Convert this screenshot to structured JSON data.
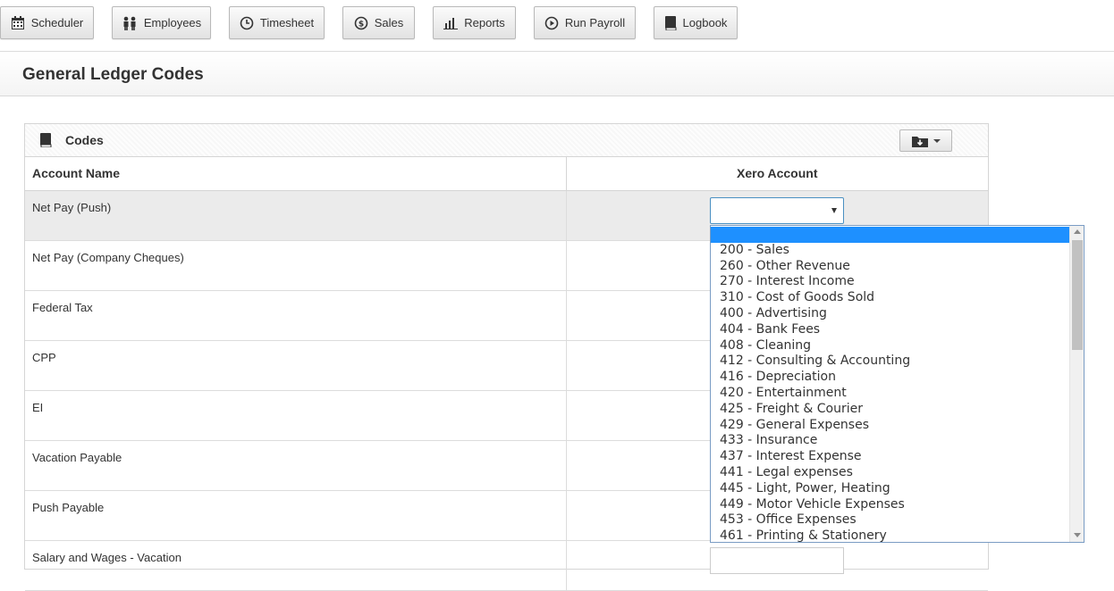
{
  "nav": {
    "items": [
      {
        "label": "Scheduler",
        "icon": "calendar-icon"
      },
      {
        "label": "Employees",
        "icon": "people-icon"
      },
      {
        "label": "Timesheet",
        "icon": "clock-icon"
      },
      {
        "label": "Sales",
        "icon": "dollar-icon"
      },
      {
        "label": "Reports",
        "icon": "bar-chart-icon"
      },
      {
        "label": "Run Payroll",
        "icon": "play-icon"
      },
      {
        "label": "Logbook",
        "icon": "book-icon"
      }
    ]
  },
  "page": {
    "title": "General Ledger Codes"
  },
  "panel": {
    "title": "Codes",
    "columns": {
      "account_name": "Account Name",
      "xero_account": "Xero Account"
    },
    "rows": [
      {
        "name": "Net Pay (Push)"
      },
      {
        "name": "Net Pay (Company Cheques)"
      },
      {
        "name": "Federal Tax"
      },
      {
        "name": "CPP"
      },
      {
        "name": "EI"
      },
      {
        "name": "Vacation Payable"
      },
      {
        "name": "Push Payable"
      },
      {
        "name": "Salary and Wages - Vacation"
      }
    ]
  },
  "dropdown": {
    "selected": "",
    "options": [
      "",
      "200 - Sales",
      "260 - Other Revenue",
      "270 - Interest Income",
      "310 - Cost of Goods Sold",
      "400 - Advertising",
      "404 - Bank Fees",
      "408 - Cleaning",
      "412 - Consulting & Accounting",
      "416 - Depreciation",
      "420 - Entertainment",
      "425 - Freight & Courier",
      "429 - General Expenses",
      "433 - Insurance",
      "437 - Interest Expense",
      "441 - Legal expenses",
      "445 - Light, Power, Heating",
      "449 - Motor Vehicle Expenses",
      "453 - Office Expenses",
      "461 - Printing & Stationery"
    ]
  },
  "colors": {
    "highlight": "#1e90ff",
    "select_border": "#4a90c2"
  }
}
